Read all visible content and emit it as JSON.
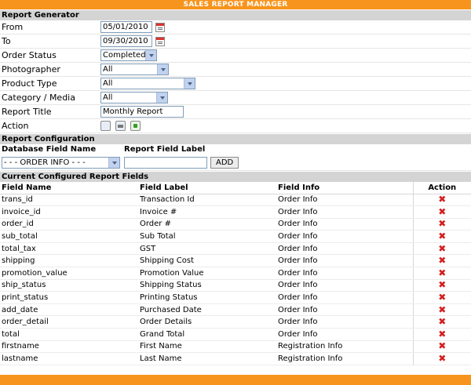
{
  "title": "SALES REPORT MANAGER",
  "generator": {
    "heading": "Report Generator",
    "from_label": "From",
    "from_value": "05/01/2010",
    "to_label": "To",
    "to_value": "09/30/2010",
    "status_label": "Order Status",
    "status_value": "Completed",
    "photographer_label": "Photographer",
    "photographer_value": "All",
    "product_type_label": "Product Type",
    "product_type_value": "All",
    "category_label": "Category / Media",
    "category_value": "All",
    "report_title_label": "Report Title",
    "report_title_value": "Monthly Report",
    "action_label": "Action",
    "icons": [
      "print-preview-icon",
      "print-icon",
      "export-icon"
    ]
  },
  "config": {
    "heading": "Report Configuration",
    "db_field_label": "Database Field Name",
    "report_field_label": "Report Field Label",
    "db_field_value": "- - - ORDER INFO - - -",
    "report_field_value": "",
    "add_label": "ADD"
  },
  "current": {
    "heading": "Current Configured Report Fields",
    "columns": [
      "Field Name",
      "Field Label",
      "Field Info",
      "Action"
    ],
    "rows": [
      [
        "trans_id",
        "Transaction Id",
        "Order Info"
      ],
      [
        "invoice_id",
        "Invoice #",
        "Order Info"
      ],
      [
        "order_id",
        "Order #",
        "Order Info"
      ],
      [
        "sub_total",
        "Sub Total",
        "Order Info"
      ],
      [
        "total_tax",
        "GST",
        "Order Info"
      ],
      [
        "shipping",
        "Shipping Cost",
        "Order Info"
      ],
      [
        "promotion_value",
        "Promotion Value",
        "Order Info"
      ],
      [
        "ship_status",
        "Shipping Status",
        "Order Info"
      ],
      [
        "print_status",
        "Printing Status",
        "Order Info"
      ],
      [
        "add_date",
        "Purchased Date",
        "Order Info"
      ],
      [
        "order_detail",
        "Order Details",
        "Order Info"
      ],
      [
        "total",
        "Grand Total",
        "Order Info"
      ],
      [
        "firstname",
        "First Name",
        "Registration Info"
      ],
      [
        "lastname",
        "Last Name",
        "Registration Info"
      ]
    ],
    "delete_glyph": "✖"
  },
  "colors": {
    "accent": "#f7941d",
    "section_bg": "#d4d4d4",
    "delete": "#d31f1f"
  }
}
